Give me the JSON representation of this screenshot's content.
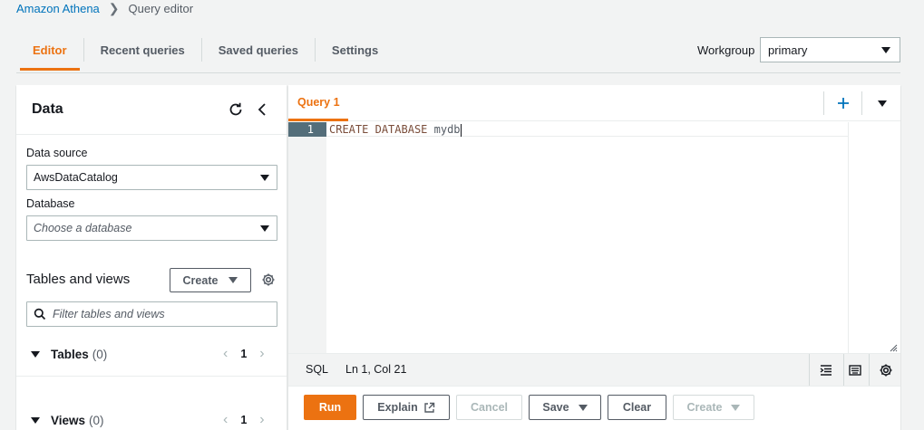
{
  "breadcrumb": {
    "root": "Amazon Athena",
    "current": "Query editor"
  },
  "tabs": [
    {
      "label": "Editor",
      "active": true
    },
    {
      "label": "Recent queries",
      "active": false
    },
    {
      "label": "Saved queries",
      "active": false
    },
    {
      "label": "Settings",
      "active": false
    }
  ],
  "workgroup": {
    "label": "Workgroup",
    "value": "primary"
  },
  "data_panel": {
    "title": "Data",
    "data_source": {
      "label": "Data source",
      "value": "AwsDataCatalog"
    },
    "database": {
      "label": "Database",
      "placeholder": "Choose a database"
    },
    "tables_and_views": {
      "title": "Tables and views",
      "create_label": "Create",
      "filter_placeholder": "Filter tables and views"
    },
    "tables": {
      "title": "Tables",
      "count": "(0)",
      "page": "1"
    },
    "views": {
      "title": "Views",
      "count": "(0)",
      "page": "1"
    }
  },
  "editor": {
    "query_tab": "Query 1",
    "line_number": "1",
    "code_keyword1": "CREATE",
    "code_keyword2": "DATABASE",
    "code_name": "mydb",
    "status_lang": "SQL",
    "status_pos": "Ln 1, Col 21"
  },
  "actions": {
    "run": "Run",
    "explain": "Explain",
    "cancel": "Cancel",
    "save": "Save",
    "clear": "Clear",
    "create": "Create"
  },
  "colors": {
    "accent": "#ec7211",
    "link": "#0073bb"
  }
}
